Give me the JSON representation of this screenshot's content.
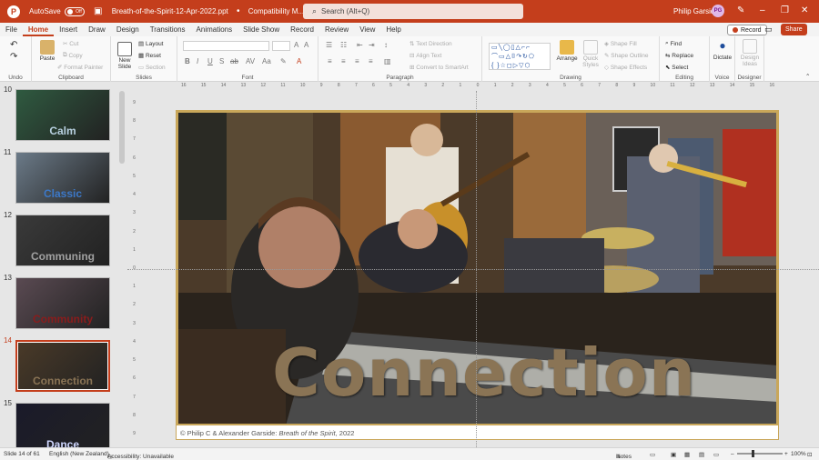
{
  "titlebar": {
    "logo": "P",
    "autosave_label": "AutoSave",
    "autosave_state": "Off",
    "doc_title": "Breath-of-the-Spirit-12-Apr-2022.ppt",
    "mode": "Compatibility M...",
    "search_placeholder": "Search (Alt+Q)",
    "user_name": "Philip Garside",
    "user_initials": "PG"
  },
  "tabs": [
    "File",
    "Home",
    "Insert",
    "Draw",
    "Design",
    "Transitions",
    "Animations",
    "Slide Show",
    "Record",
    "Review",
    "View",
    "Help"
  ],
  "active_tab": "Home",
  "record_label": "Record",
  "share_label": "Share",
  "ribbon": {
    "undo_label": "Undo",
    "clipboard": {
      "paste": "Paste",
      "cut": "Cut",
      "copy": "Copy",
      "format_painter": "Format Painter",
      "label": "Clipboard"
    },
    "slides": {
      "new_slide": "New Slide",
      "layout": "Layout",
      "reset": "Reset",
      "section": "Section",
      "label": "Slides"
    },
    "font": {
      "label": "Font"
    },
    "paragraph": {
      "text_direction": "Text Direction",
      "align_text": "Align Text",
      "convert": "Convert to SmartArt",
      "label": "Paragraph"
    },
    "drawing": {
      "arrange": "Arrange",
      "quick_styles": "Quick Styles",
      "shape_fill": "Shape Fill",
      "shape_outline": "Shape Outline",
      "shape_effects": "Shape Effects",
      "label": "Drawing"
    },
    "editing": {
      "find": "Find",
      "replace": "Replace",
      "select": "Select",
      "label": "Editing"
    },
    "voice": {
      "dictate": "Dictate",
      "label": "Voice"
    },
    "designer": {
      "ideas": "Design Ideas",
      "label": "Designer"
    }
  },
  "thumbnails": [
    {
      "number": "10",
      "label": "Calm",
      "label_color": "#b8d0e0",
      "bg": "#2f5a40"
    },
    {
      "number": "11",
      "label": "Classic",
      "label_color": "#3c78c8",
      "bg": "#6b7a88"
    },
    {
      "number": "12",
      "label": "Communing",
      "label_color": "#a0a0a0",
      "bg": "#3a3a3a"
    },
    {
      "number": "13",
      "label": "Community",
      "label_color": "#8a1c1c",
      "bg": "#5a4a52"
    },
    {
      "number": "14",
      "label": "Connection",
      "label_color": "#8a7455",
      "bg": "#4a3a28",
      "active": true
    },
    {
      "number": "15",
      "label": "Dance",
      "label_color": "#d0d8ff",
      "bg": "#1a1a2a"
    }
  ],
  "slide": {
    "title": "Connection",
    "caption_prefix": "© Philip C & Alexander Garside: ",
    "caption_work": "Breath of the Spirit",
    "caption_suffix": ", 2022"
  },
  "ruler": {
    "h_ticks": [
      "16",
      "15",
      "14",
      "13",
      "12",
      "11",
      "10",
      "9",
      "8",
      "7",
      "6",
      "5",
      "4",
      "3",
      "2",
      "1",
      "0",
      "1",
      "2",
      "3",
      "4",
      "5",
      "6",
      "7",
      "8",
      "9",
      "10",
      "11",
      "12",
      "13",
      "14",
      "15",
      "16"
    ],
    "v_ticks": [
      "9",
      "8",
      "7",
      "6",
      "5",
      "4",
      "3",
      "2",
      "1",
      "0",
      "1",
      "2",
      "3",
      "4",
      "5",
      "6",
      "7",
      "8",
      "9"
    ]
  },
  "status": {
    "slide_info": "Slide 14 of 61",
    "language": "English (New Zealand)",
    "accessibility": "Accessibility: Unavailable",
    "notes": "Notes",
    "zoom": "100%"
  },
  "colors": {
    "accent": "#c43e1c",
    "slide_frame": "#c9a75a"
  }
}
